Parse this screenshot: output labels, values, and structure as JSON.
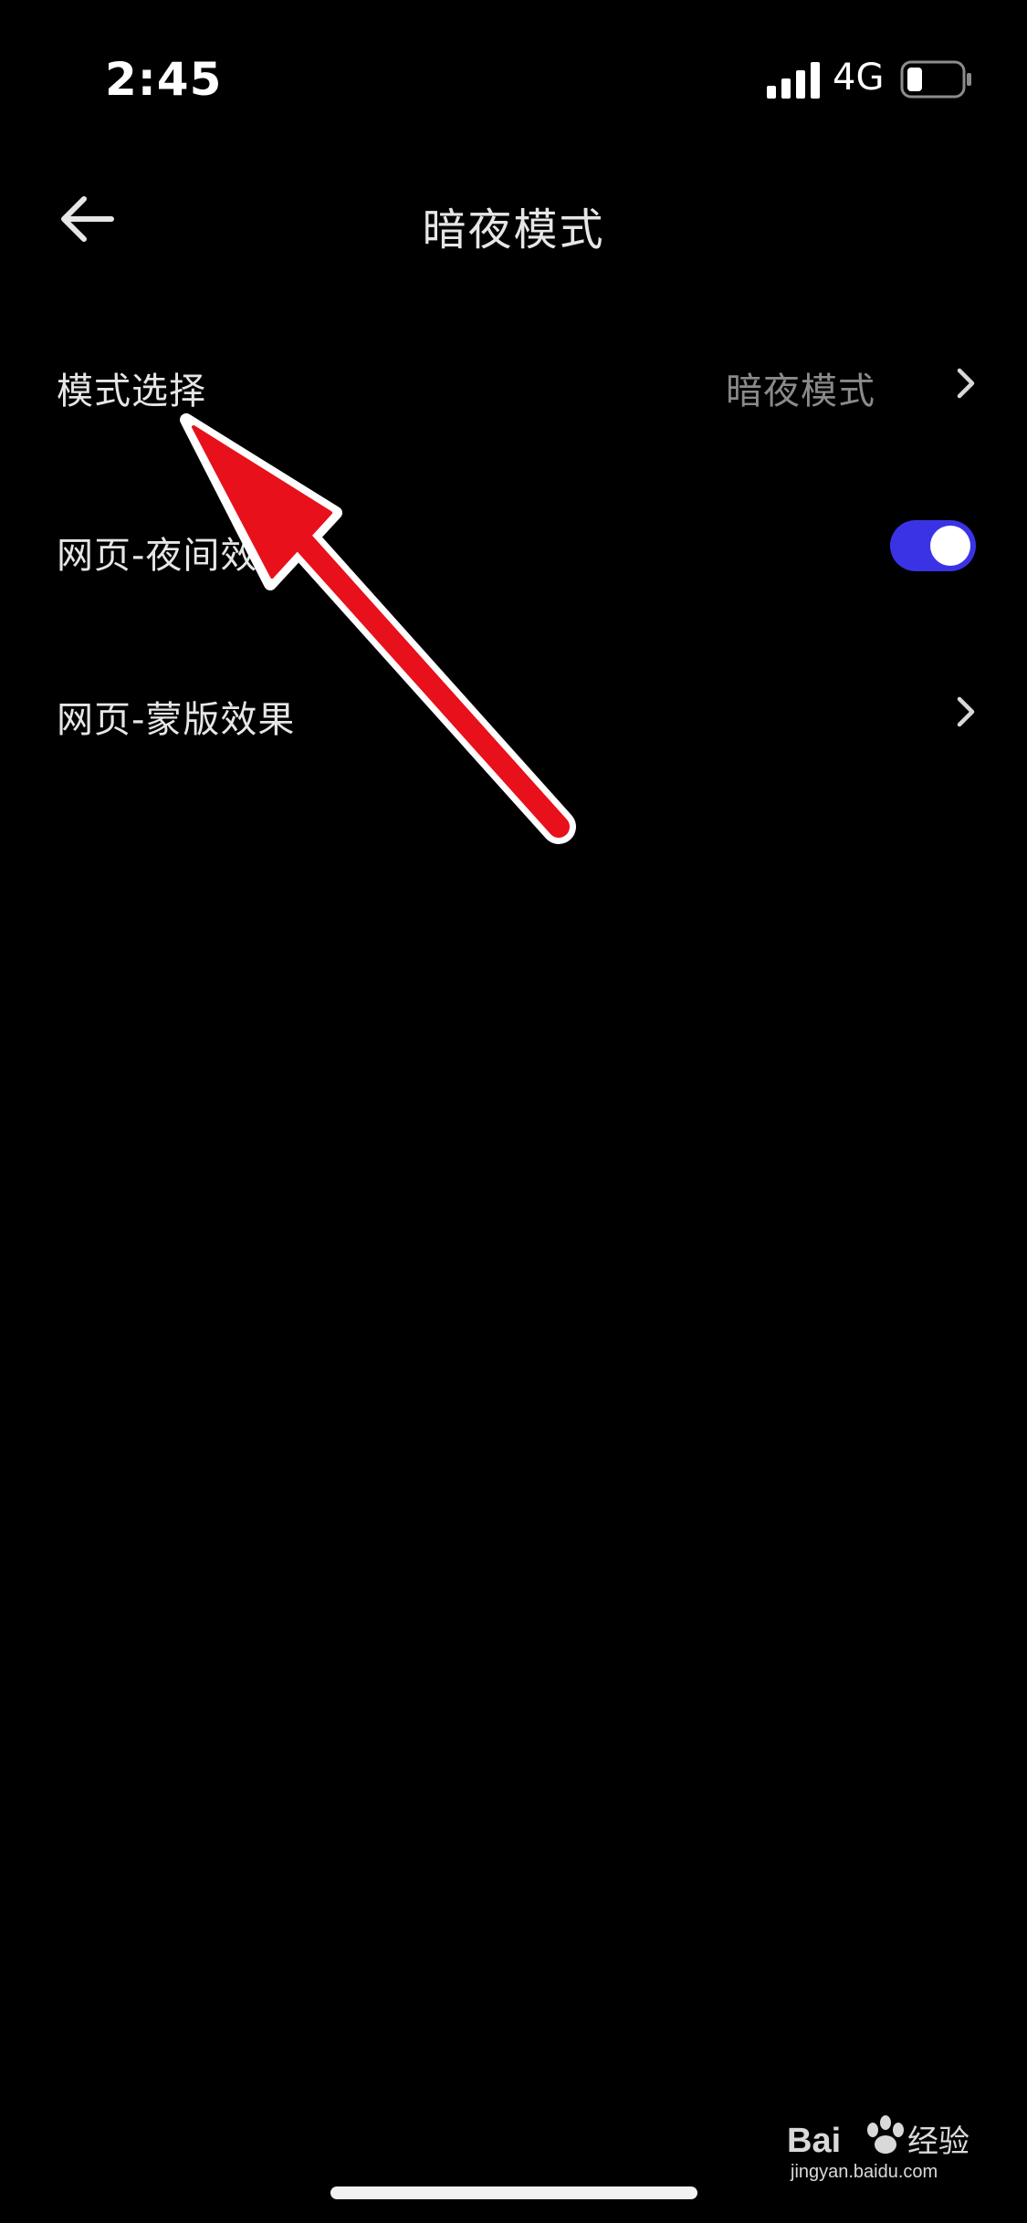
{
  "status_bar": {
    "time": "2:45",
    "network": "4G",
    "battery_level": 0.2,
    "signal_bars": 4
  },
  "nav": {
    "back_icon": "arrow-left-icon",
    "title": "暗夜模式"
  },
  "settings": {
    "mode_select": {
      "label": "模式选择",
      "value": "暗夜模式",
      "icon": "chevron-right-icon"
    },
    "web_night": {
      "label": "网页-夜间效果",
      "toggle_on": true
    },
    "web_mask": {
      "label": "网页-蒙版效果",
      "icon": "chevron-right-icon"
    }
  },
  "watermark": {
    "brand": "Baidu经验",
    "url": "jingyan.baidu.com"
  },
  "colors": {
    "background": "#000000",
    "toggle_on": "#3a33e6",
    "annotation_arrow": "#e8101b"
  }
}
